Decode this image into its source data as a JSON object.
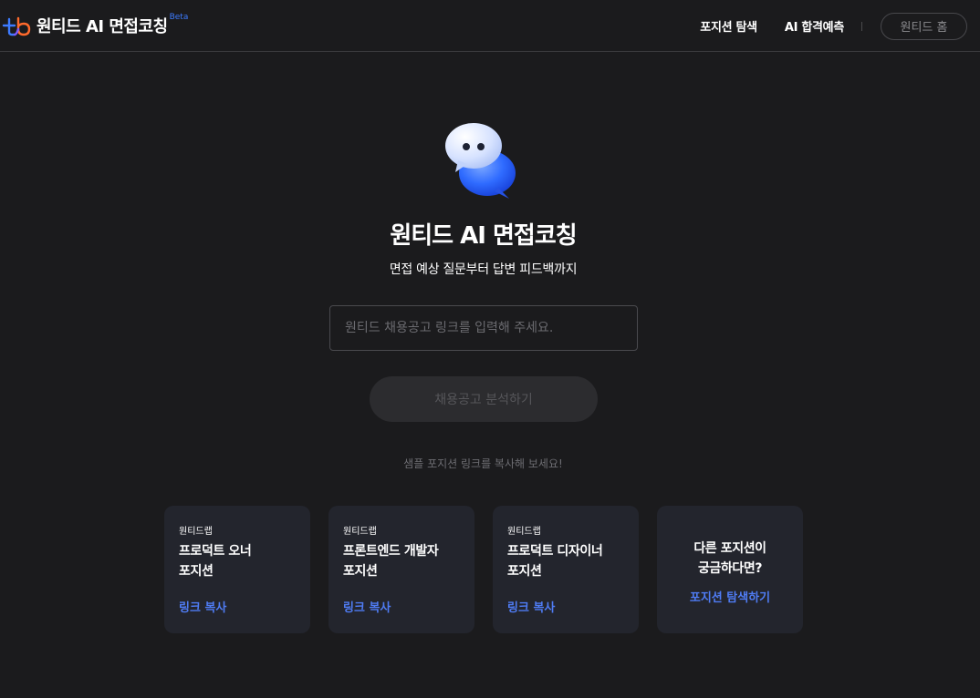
{
  "header": {
    "title": "원티드 AI 면접코칭",
    "beta": "Beta",
    "nav": [
      "포지션 탐색",
      "AI 합격예측"
    ],
    "home_button": "원티드 홈"
  },
  "hero": {
    "title": "원티드 AI 면접코칭",
    "subtitle": "면접 예상 질문부터 답변 피드백까지",
    "input_placeholder": "원티드 채용공고 링크를 입력해 주세요.",
    "input_value": "",
    "analyze_button": "채용공고 분석하기",
    "hint": "샘플 포지션 링크를 복사해 보세요!"
  },
  "cards": [
    {
      "company": "원티드랩",
      "title_line1": "프로덕트 오너",
      "title_line2": "포지션",
      "link": "링크 복사"
    },
    {
      "company": "원티드랩",
      "title_line1": "프론트엔드 개발자",
      "title_line2": "포지션",
      "link": "링크 복사"
    },
    {
      "company": "원티드랩",
      "title_line1": "프로덕트 디자이너",
      "title_line2": "포지션",
      "link": "링크 복사"
    }
  ],
  "more_card": {
    "title_line1": "다른 포지션이",
    "title_line2": "궁금하다면?",
    "link": "포지션 탐색하기"
  },
  "colors": {
    "background": "#1b1b1d",
    "accent": "#4f7cf4",
    "card": "#23252d"
  },
  "icons": [
    "wanted-logo-icon",
    "chat-bubbles-icon"
  ]
}
